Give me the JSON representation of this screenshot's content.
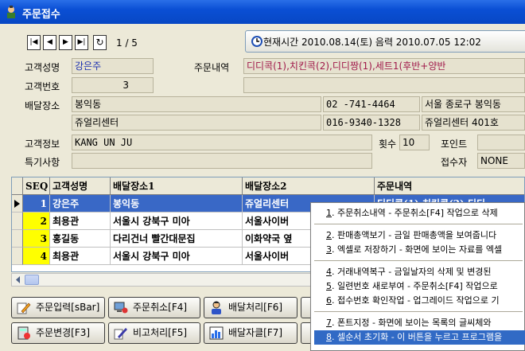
{
  "window": {
    "title": "주문접수"
  },
  "nav": {
    "first": "|◀",
    "prev": "◀",
    "next": "▶",
    "last": "▶|",
    "refresh": "↻",
    "record_pos": "1 / 5"
  },
  "time_button": {
    "label": "현재시간 2010.08.14(토) 음력 2010.07.05 12:02"
  },
  "form": {
    "customer_name_label": "고객성명",
    "customer_name": "강은주",
    "customer_no_label": "고객번호",
    "customer_no": "3",
    "order_label": "주문내역",
    "order_value": "디디콕(1),치킨콕(2),디디짱(1),세트1(후반+양반",
    "address_label": "배달장소",
    "addr1": "봉익동",
    "addr2": "쥬얼리센터",
    "phone1": "02   -741-4464",
    "phone2": "016-9340-1328",
    "addr_detail1": "서울 종로구 봉익동",
    "addr_detail2": "쥬얼리센터 401호",
    "info_label": "고객정보",
    "info_value": "KANG UN JU",
    "count_label": "횟수",
    "count_value": "10",
    "point_label": "포인트",
    "special_label": "특기사항",
    "receiver_label": "접수자",
    "receiver_value": "NONE"
  },
  "grid": {
    "headers": [
      "SEQ",
      "고객성명",
      "배달장소1",
      "배달장소2",
      "주문내역"
    ],
    "rows": [
      [
        "1",
        "강은주",
        "봉익동",
        "쥬얼리센터",
        "디디콕(1),치킨콕(2),디디"
      ],
      [
        "2",
        "최용관",
        "서울시 강북구 미아",
        "서울사이버",
        ""
      ],
      [
        "3",
        "홍길동",
        "다리건너 빨간대문집",
        "이화약국 옆",
        ""
      ],
      [
        "4",
        "최용관",
        "서울시 강북구 미아",
        "서울사이버",
        ""
      ]
    ]
  },
  "buttons": {
    "order_input": "주문입력[sBar]",
    "order_cancel": "주문취소[F4]",
    "delivery": "배달처리[F6]",
    "order_change": "주문변경[F3]",
    "note": "비고처리[F5]",
    "delivery_man": "배달자클[F7]"
  },
  "context_menu": {
    "items": [
      {
        "num": "1",
        "text": ". 주문취소내역 - 주문취소[F4] 작업으로 삭제"
      },
      {
        "num": "2",
        "text": ". 판매총액보기 - 금일 판매총액을 보여줍니다"
      },
      {
        "num": "3",
        "text": ". 엑셀로 저장하기 - 화면에 보이는 자료를 엑셀"
      },
      {
        "num": "4",
        "text": ". 거래내역복구 - 금일날자의 삭제 및 변경된 "
      },
      {
        "num": "5",
        "text": ". 일련번호 새로부여 - 주문취소[F4] 작업으로"
      },
      {
        "num": "6",
        "text": ". 접수번호 확인작업 - 업그레이드 작업으로 기"
      },
      {
        "num": "7",
        "text": ". 폰트지정 - 화면에 보이는 목록의 글씨체와"
      },
      {
        "num": "8",
        "text": ". 셀순서 초기화 - 이 버튼을 누르고 프로그램을"
      }
    ]
  },
  "colors": {
    "title": "#0a4fd4",
    "selection": "#3968c6",
    "seq_bg": "#ffff00",
    "field_bg": "#e6e2cf"
  }
}
